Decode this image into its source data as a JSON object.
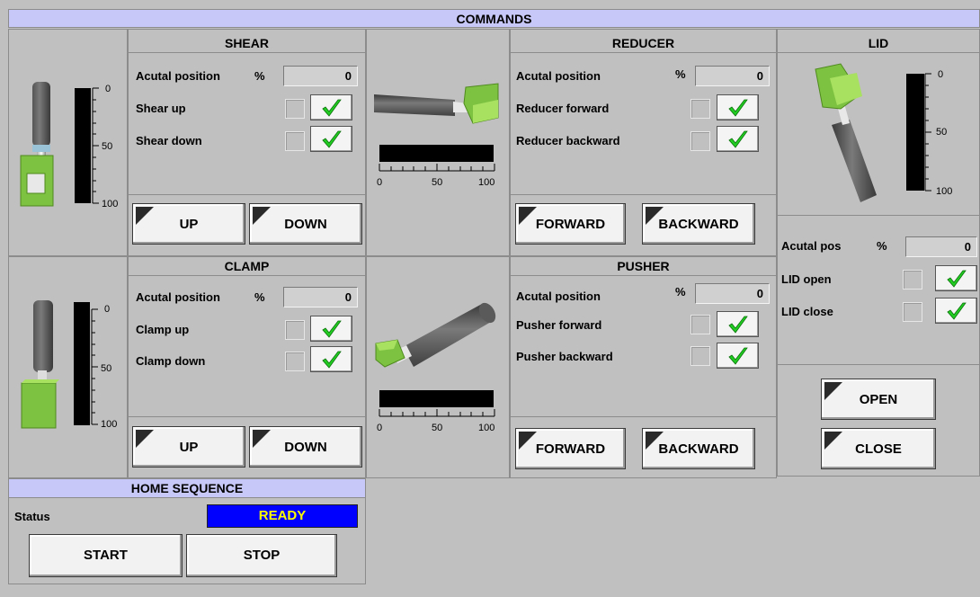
{
  "title": "COMMANDS",
  "shear": {
    "header": "SHEAR",
    "pos_label": "Acutal position",
    "pct": "%",
    "pos_value": "0",
    "up_label": "Shear up",
    "down_label": "Shear down",
    "btn_up": "UP",
    "btn_down": "DOWN",
    "scale": [
      "0",
      "50",
      "100"
    ]
  },
  "clamp": {
    "header": "CLAMP",
    "pos_label": "Acutal position",
    "pct": "%",
    "pos_value": "0",
    "up_label": "Clamp up",
    "down_label": "Clamp down",
    "btn_up": "UP",
    "btn_down": "DOWN",
    "scale": [
      "0",
      "50",
      "100"
    ]
  },
  "reducer": {
    "header": "REDUCER",
    "pos_label": "Acutal position",
    "pct": "%",
    "pos_value": "0",
    "fwd_label": "Reducer forward",
    "bwd_label": "Reducer backward",
    "btn_fwd": "FORWARD",
    "btn_bwd": "BACKWARD",
    "scale": [
      "0",
      "50",
      "100"
    ]
  },
  "pusher": {
    "header": "PUSHER",
    "pos_label": "Acutal position",
    "pct": "%",
    "pos_value": "0",
    "fwd_label": "Pusher forward",
    "bwd_label": "Pusher backward",
    "btn_fwd": "FORWARD",
    "btn_bwd": "BACKWARD",
    "scale": [
      "0",
      "50",
      "100"
    ]
  },
  "lid": {
    "header": "LID",
    "pos_label": "Acutal pos",
    "pct": "%",
    "pos_value": "0",
    "open_label": "LID open",
    "close_label": "LID close",
    "btn_open": "OPEN",
    "btn_close": "CLOSE",
    "scale": [
      "0",
      "50",
      "100"
    ]
  },
  "home": {
    "header": "HOME SEQUENCE",
    "status_label": "Status",
    "status_value": "READY",
    "btn_start": "START",
    "btn_stop": "STOP"
  },
  "colors": {
    "header_bg": "#c8c8f8",
    "status_bg": "#0000ff",
    "status_text": "#ffff00",
    "machine_green": "#7ec242",
    "check_green": "#22cc22"
  }
}
